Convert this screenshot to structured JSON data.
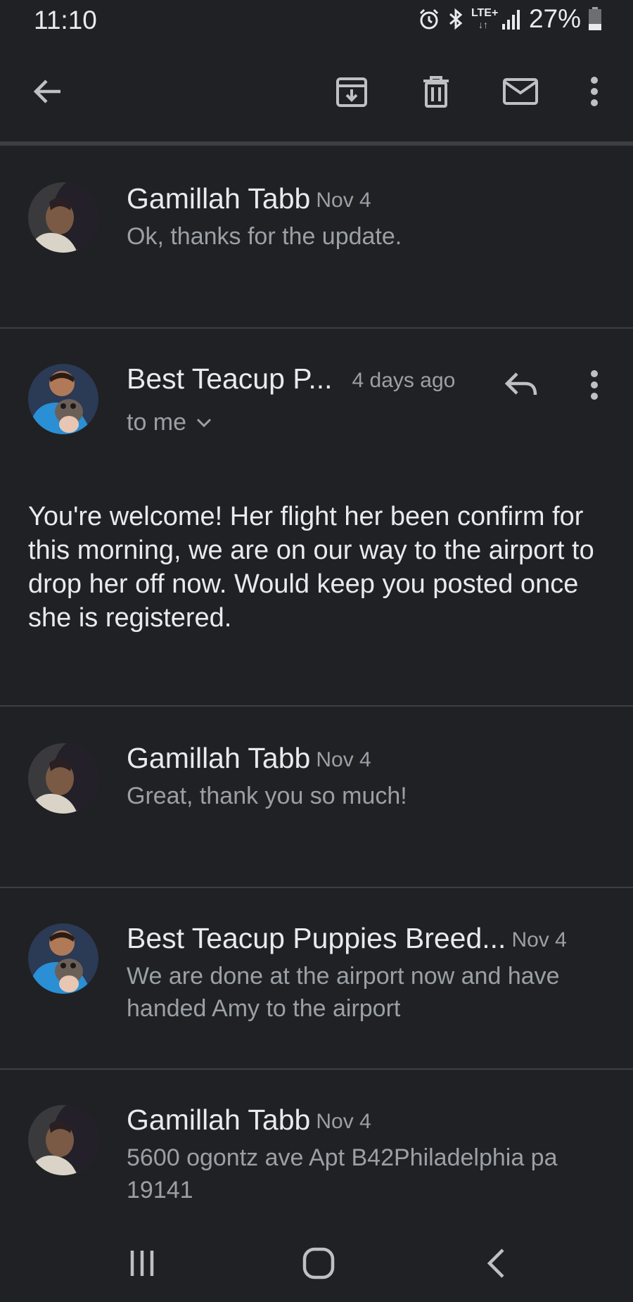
{
  "status_bar": {
    "time": "11:10",
    "network": "LTE+",
    "battery": "27%",
    "icons": [
      "alarm-icon",
      "bluetooth-icon",
      "lte-icon",
      "signal-icon",
      "battery-icon"
    ]
  },
  "toolbar": {
    "icons": [
      "back-arrow-icon",
      "archive-icon",
      "delete-icon",
      "mark-unread-icon",
      "more-vert-icon"
    ]
  },
  "messages": [
    {
      "sender": "Gamillah Tabb",
      "date": "Nov 4",
      "snippet": "Ok, thanks for the update."
    },
    {
      "sender": "Best Teacup P...",
      "date": "4 days ago",
      "recipient": "to me",
      "body": "You're welcome! Her flight her been confirm for this morning, we are on our way to the airport to drop her off now. Would keep you posted once she is registered."
    },
    {
      "sender": "Gamillah Tabb",
      "date": "Nov 4",
      "snippet": "Great, thank you so much!"
    },
    {
      "sender": "Best Teacup Puppies Breed...",
      "date": "Nov 4",
      "snippet": "We are done at the airport now and have handed Amy to the airport"
    },
    {
      "sender": "Gamillah Tabb",
      "date": "Nov 4",
      "snippet": "5600 ogontz ave Apt B42Philadelphia pa 19141"
    }
  ],
  "nav_bar": {
    "icons": [
      "recent-apps-icon",
      "home-icon",
      "back-icon"
    ]
  },
  "colors": {
    "background": "#202124",
    "primary_text": "#e8eaed",
    "secondary_text": "#9aa0a6",
    "divider": "#3c4043"
  }
}
